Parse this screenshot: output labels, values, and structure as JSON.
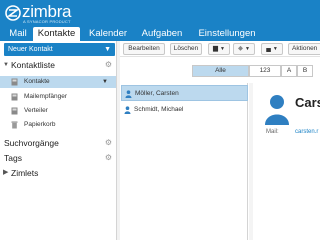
{
  "app": {
    "logo_text": "zimbra",
    "logo_subtitle": "A SYNACOR PRODUCT"
  },
  "tabs": [
    {
      "label": "Mail"
    },
    {
      "label": "Kontakte"
    },
    {
      "label": "Kalender"
    },
    {
      "label": "Aufgaben"
    },
    {
      "label": "Einstellungen"
    }
  ],
  "sidebar": {
    "new_button": "Neuer Kontakt",
    "contact_list_header": "Kontaktliste",
    "items": [
      {
        "label": "Kontakte",
        "icon": "address-book-icon"
      },
      {
        "label": "Mailempfänger",
        "icon": "address-book-icon"
      },
      {
        "label": "Verteiler",
        "icon": "address-book-icon"
      },
      {
        "label": "Papierkorb",
        "icon": "trash-icon"
      }
    ],
    "searches_header": "Suchvorgänge",
    "tags_header": "Tags",
    "zimlets_header": "Zimlets"
  },
  "toolbar": {
    "edit": "Bearbeiten",
    "delete": "Löschen",
    "actions": "Aktionen"
  },
  "alphabar": [
    "Alle",
    "123",
    "A",
    "B"
  ],
  "contacts": [
    {
      "name": "Möller, Carsten"
    },
    {
      "name": "Schmidt, Michael"
    }
  ],
  "detail": {
    "name": "Carst",
    "mail_label": "Mail:",
    "mail_value": "carsten.r"
  },
  "colors": {
    "accent": "#1a82c6",
    "selection": "#bcd9ee"
  }
}
